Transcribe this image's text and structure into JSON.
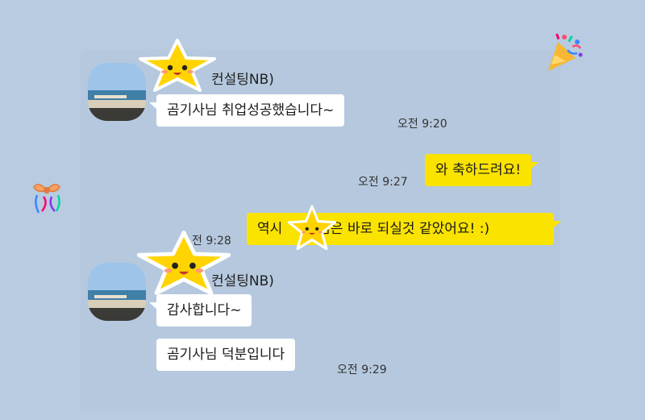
{
  "messages": {
    "group1": {
      "sender": "컨설팅NB)",
      "text": "곰기사님 취업성공했습니다~",
      "time": "오전 9:20"
    },
    "mine1": {
      "text": "와 축하드려요!",
      "time": "오전 9:27"
    },
    "mine2": {
      "text_before": "역시",
      "text_after": "님은 바로 되실것 같았어요! :)",
      "time": "전 9:28"
    },
    "group2": {
      "sender": "컨설팅NB)",
      "text1": "감사합니다~",
      "text2": "곰기사님 덕분입니다",
      "time": "오전 9:29"
    }
  },
  "colors": {
    "background": "#b8cbe1",
    "bubble_out": "#fbe300",
    "bubble_in": "#ffffff",
    "star": "#ffd400"
  },
  "icons": [
    "party-popper-icon",
    "gift-ribbon-icon",
    "star-face-sticker"
  ]
}
